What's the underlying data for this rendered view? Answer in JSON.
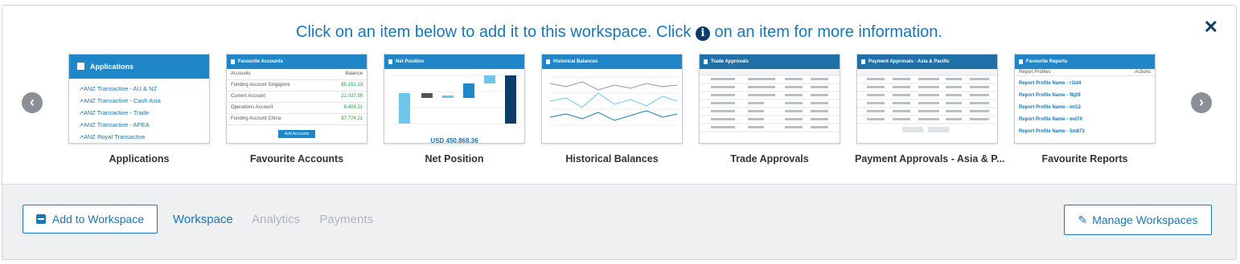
{
  "header": {
    "instruction_before": "Click on an item below to add it to this workspace. Click",
    "instruction_after": "on an item for more information.",
    "info_glyph": "i",
    "close_glyph": "✕"
  },
  "carousel": {
    "prev_glyph": "‹",
    "next_glyph": "›",
    "tiles": [
      {
        "label": "Applications"
      },
      {
        "label": "Favourite Accounts"
      },
      {
        "label": "Net Position"
      },
      {
        "label": "Historical Balances"
      },
      {
        "label": "Trade Approvals"
      },
      {
        "label": "Payment Approvals - Asia & P..."
      },
      {
        "label": "Favourite Reports"
      }
    ]
  },
  "thumbs": {
    "applications": {
      "title": "Applications",
      "items": [
        "ANZ Transactive - AU & NZ",
        "ANZ Transactive - Cash Asia",
        "ANZ Transactive - Trade",
        "ANZ Transactive - APEA",
        "ANZ Royal Transactive"
      ]
    },
    "favourite_accounts": {
      "title": "Favourite Accounts",
      "col_accounts": "Accounts",
      "col_balance": "Balance",
      "rows": [
        {
          "name": "Funding Account Singapore",
          "value": "$5,161.23"
        },
        {
          "name": "Current Account",
          "value": "21,037.95"
        },
        {
          "name": "Operations Account",
          "value": "8,408.21"
        },
        {
          "name": "Funding Account China",
          "value": "$7,774.21"
        }
      ],
      "button": "Add Accounts"
    },
    "net_position": {
      "title": "Net Position",
      "total": "USD 450,868.36"
    },
    "historical_balances": {
      "title": "Historical Balances"
    },
    "trade_approvals": {
      "title": "Trade Approvals"
    },
    "payment_approvals": {
      "title": "Payment Approvals - Asia & Pacific"
    },
    "favourite_reports": {
      "title": "Favourite Reports",
      "col": "Report Profiles",
      "col_actions": "Actions",
      "items": [
        "Report Profile Name - r1id4",
        "Report Profile Name - f8j29",
        "Report Profile Name - mt12",
        "Report Profile Name - md74",
        "Report Profile Name - 5m873"
      ]
    }
  },
  "footer": {
    "add_button": "Add to Workspace",
    "tabs": [
      {
        "label": "Workspace",
        "active": true
      },
      {
        "label": "Analytics",
        "active": false
      },
      {
        "label": "Payments",
        "active": false
      }
    ],
    "manage_button": "Manage Workspaces"
  },
  "colors": {
    "accent": "#1a77b5",
    "header_bar": "#1f86c7",
    "dark_navy": "#0f3d6b",
    "inactive_tab": "#b0b5ba"
  }
}
